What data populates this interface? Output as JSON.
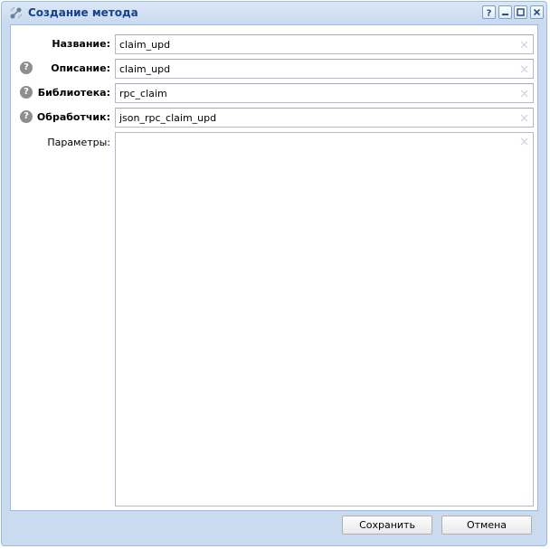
{
  "window": {
    "title": "Создание метода",
    "title_icon": "method-icon",
    "tools": [
      "help-icon",
      "minimize-icon",
      "maximize-icon",
      "close-icon"
    ]
  },
  "form": {
    "fields": [
      {
        "label": "Название:",
        "value": "claim_upd",
        "has_help": false
      },
      {
        "label": "Описание:",
        "value": "claim_upd",
        "has_help": true
      },
      {
        "label": "Библиотека:",
        "value": "rpc_claim",
        "has_help": true
      },
      {
        "label": "Обработчик:",
        "value": "json_rpc_claim_upd",
        "has_help": true
      }
    ],
    "params_label": "Параметры:",
    "params_value": "",
    "help_glyph": "?"
  },
  "buttons": {
    "save": "Сохранить",
    "cancel": "Отмена"
  },
  "colors": {
    "title_text": "#15428b",
    "frame": "#cbdbef",
    "border": "#99bbe8"
  }
}
